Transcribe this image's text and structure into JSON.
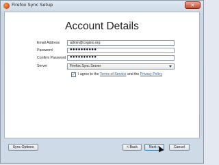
{
  "window": {
    "title": "Firefox Sync Setup",
    "close_icon": "close-icon",
    "close_glyph": "×"
  },
  "main": {
    "heading": "Account Details",
    "fields": {
      "email": {
        "label": "Email Address",
        "value": "admin@cogizio.org"
      },
      "password": {
        "label": "Password",
        "value": "●●●●●●●●●●"
      },
      "confirm_password": {
        "label": "Confirm Password",
        "value": "●●●●●●●●●●"
      },
      "server": {
        "label": "Server",
        "selected": "Firefox Sync Server"
      }
    },
    "agreement": {
      "checked": true,
      "check_glyph": "✓",
      "prefix": "I agree to the ",
      "terms_link": "Terms of Service",
      "middle": " and the ",
      "privacy_link": "Privacy Policy"
    }
  },
  "footer": {
    "sync_options": "Sync Options",
    "back": "< Back",
    "next": "Next >",
    "cancel": "Cancel"
  }
}
